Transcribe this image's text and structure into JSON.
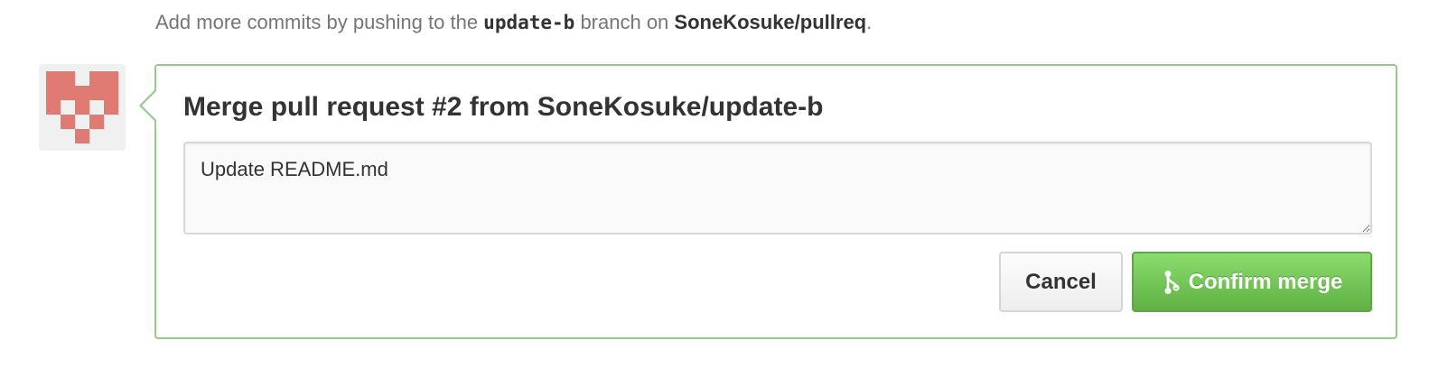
{
  "hint": {
    "prefix": "Add more commits by pushing to the ",
    "branch": "update-b",
    "middle": " branch on ",
    "repo": "SoneKosuke/pullreq",
    "suffix": "."
  },
  "avatar": {
    "icon": "identicon",
    "color": "#e07b74"
  },
  "merge": {
    "title": "Merge pull request #2 from SoneKosuke/update-b",
    "message": "Update README.md",
    "cancel_label": "Cancel",
    "confirm_label": "Confirm merge",
    "confirm_icon": "git-merge-icon"
  },
  "colors": {
    "box_border": "#95c98e",
    "confirm_bg": "#6cc644",
    "cancel_bg": "#f5f5f5"
  }
}
